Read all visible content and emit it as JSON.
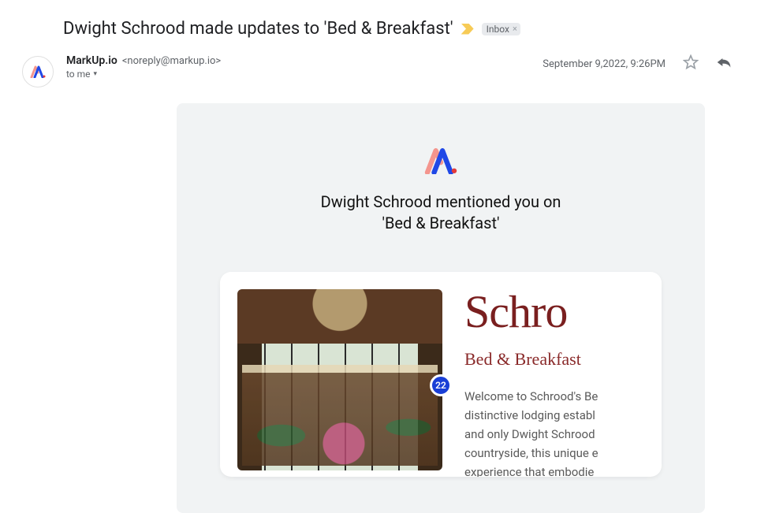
{
  "subject": "Dwight Schrood made updates to 'Bed & Breakfast'",
  "inbox_label": "Inbox",
  "sender": {
    "name": "MarkUp.io",
    "email": "<noreply@markup.io>"
  },
  "to_line": "to me",
  "timestamp": "September 9,2022, 9:26PM",
  "body": {
    "headline_line1": "Dwight Schrood mentioned you on",
    "headline_line2": "'Bed & Breakfast'",
    "annotation_count": "22",
    "card": {
      "brand": "Schro",
      "brand_sub": "Bed & Breakfast",
      "desc_l1": "Welcome to Schrood's Be",
      "desc_l2": "distinctive lodging establ",
      "desc_l3": "and only Dwight Schrood",
      "desc_l4": "countryside, this unique e",
      "desc_l5": "experience that embodie"
    }
  }
}
